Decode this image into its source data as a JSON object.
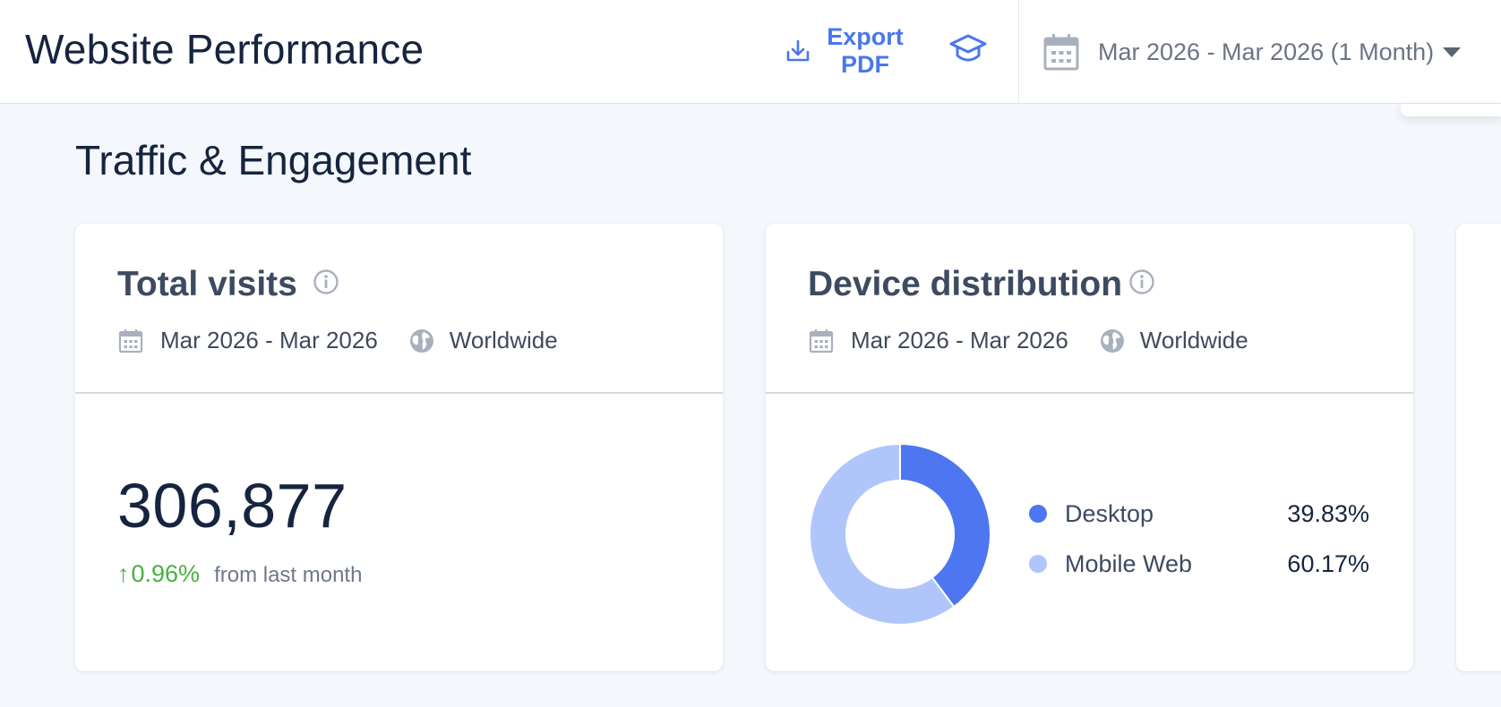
{
  "header": {
    "title": "Website Performance",
    "export_label": "Export\nPDF",
    "date_range": "Mar 2026 - Mar 2026 (1 Month)"
  },
  "section": {
    "title": "Traffic & Engagement"
  },
  "total_visits": {
    "title": "Total visits",
    "date": "Mar 2026 - Mar 2026",
    "geo": "Worldwide",
    "value": "306,877",
    "change_arrow": "↑",
    "change": "0.96%",
    "change_caption": "from last month"
  },
  "device_distribution": {
    "title": "Device distribution",
    "date": "Mar 2026 - Mar 2026",
    "geo": "Worldwide",
    "items": [
      {
        "label": "Desktop",
        "value": "39.83%",
        "share": 39.83,
        "color": "#4d76f0"
      },
      {
        "label": "Mobile Web",
        "value": "60.17%",
        "share": 60.17,
        "color": "#b0c6fb"
      }
    ]
  },
  "colors": {
    "accent": "#4a77f0",
    "positive": "#48b042"
  }
}
